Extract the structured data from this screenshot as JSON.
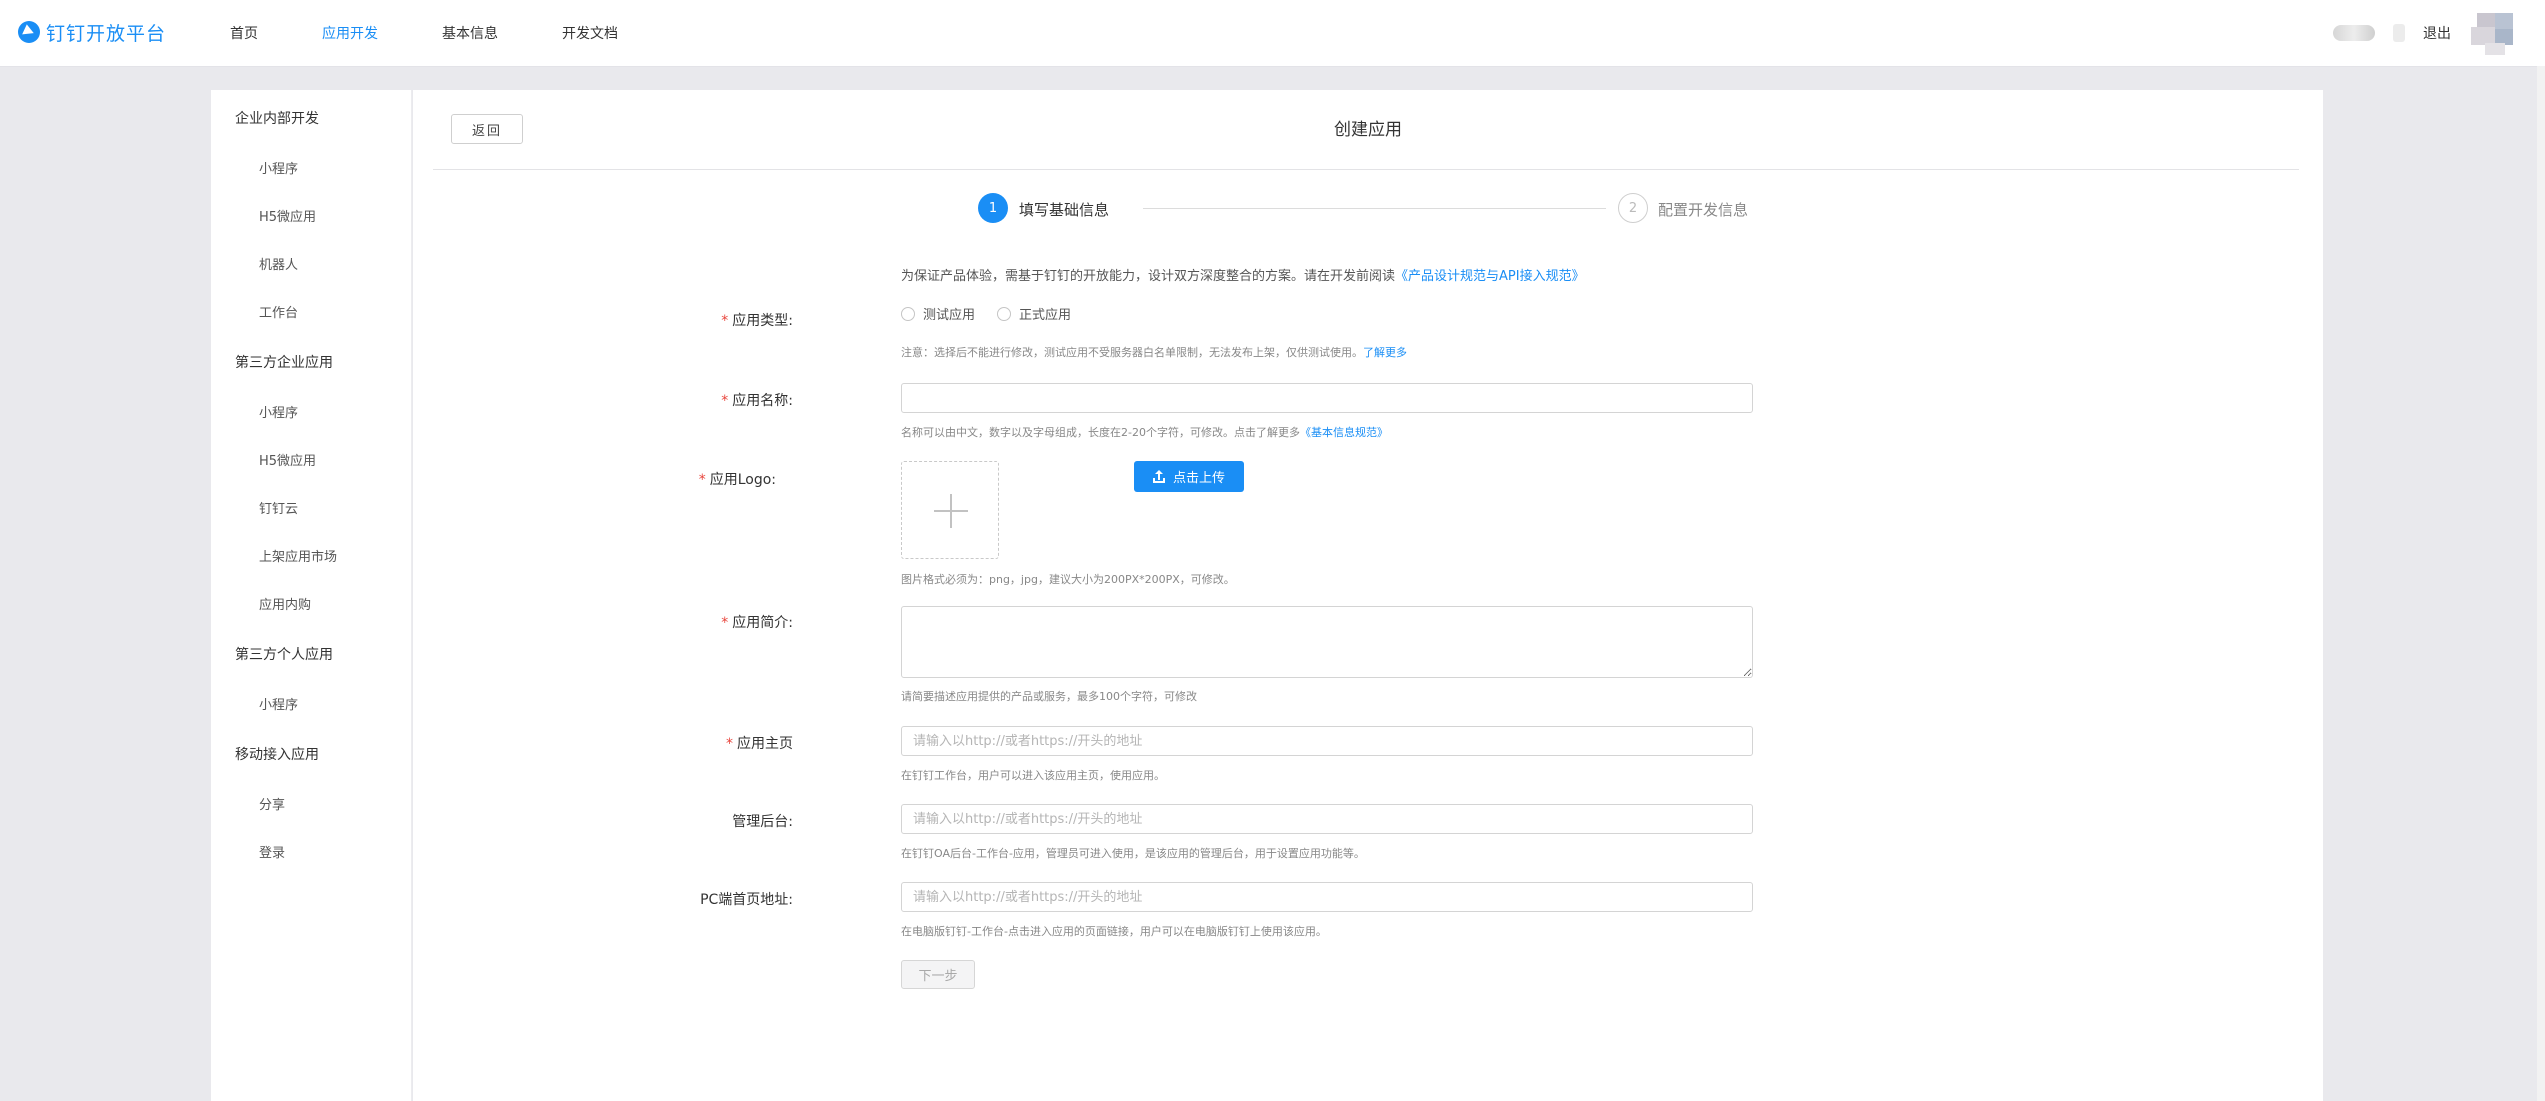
{
  "header": {
    "logo_text": "钉钉开放平台",
    "nav": [
      {
        "label": "首页"
      },
      {
        "label": "应用开发",
        "active": true
      },
      {
        "label": "基本信息"
      },
      {
        "label": "开发文档"
      }
    ],
    "logout": "退出"
  },
  "sidebar": {
    "groups": [
      {
        "title": "企业内部开发",
        "items": [
          "小程序",
          "H5微应用",
          "机器人",
          "工作台"
        ]
      },
      {
        "title": "第三方企业应用",
        "items": [
          "小程序",
          "H5微应用",
          "钉钉云",
          "上架应用市场",
          "应用内购"
        ]
      },
      {
        "title": "第三方个人应用",
        "items": [
          "小程序"
        ]
      },
      {
        "title": "移动接入应用",
        "items": [
          "分享",
          "登录"
        ]
      }
    ]
  },
  "main": {
    "back_label": "返回",
    "title": "创建应用",
    "steps": [
      {
        "number": "1",
        "label": "填写基础信息",
        "active": true
      },
      {
        "number": "2",
        "label": "配置开发信息",
        "active": false
      }
    ],
    "intro_text": "为保证产品体验，需基于钉钉的开放能力，设计双方深度整合的方案。请在开发前阅读",
    "intro_link": "《产品设计规范与API接入规范》",
    "form": {
      "app_type": {
        "label": "应用类型:",
        "options": [
          "测试应用",
          "正式应用"
        ],
        "hint": "注意：选择后不能进行修改，测试应用不受服务器白名单限制，无法发布上架，仅供测试使用。",
        "hint_link": "了解更多"
      },
      "app_name": {
        "label": "应用名称:",
        "value": "",
        "hint": "名称可以由中文，数字以及字母组成，长度在2-20个字符，可修改。点击了解更多",
        "hint_link": "《基本信息规范》"
      },
      "app_logo": {
        "label": "应用Logo:",
        "upload_label": "点击上传",
        "hint": "图片格式必须为：png，jpg，建议大小为200PX*200PX，可修改。"
      },
      "app_desc": {
        "label": "应用简介:",
        "value": "",
        "hint": "请简要描述应用提供的产品或服务，最多100个字符，可修改"
      },
      "app_home": {
        "label": "应用主页",
        "placeholder": "请输入以http://或者https://开头的地址",
        "hint": "在钉钉工作台，用户可以进入该应用主页，使用应用。"
      },
      "admin_backend": {
        "label": "管理后台:",
        "placeholder": "请输入以http://或者https://开头的地址",
        "hint": "在钉钉OA后台-工作台-应用，管理员可进入使用，是该应用的管理后台，用于设置应用功能等。"
      },
      "pc_home": {
        "label": "PC端首页地址:",
        "placeholder": "请输入以http://或者https://开头的地址",
        "hint": "在电脑版钉钉-工作台-点击进入应用的页面链接，用户可以在电脑版钉钉上使用该应用。"
      }
    },
    "next_label": "下一步"
  },
  "colors": {
    "accent": "#1a8ef5",
    "required": "#e8443b",
    "page_bg": "#e9e9ed"
  }
}
